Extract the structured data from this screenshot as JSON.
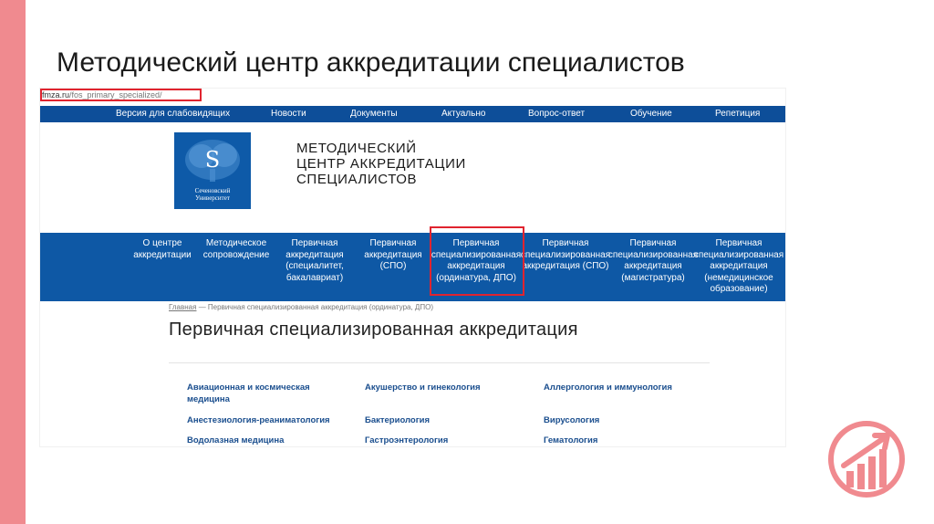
{
  "slide_title": "Методический центр аккредитации специалистов",
  "url": {
    "domain": "fmza.ru",
    "path": "/fos_primary_specialized/"
  },
  "top_nav": [
    "Версия для слабовидящих",
    "Новости",
    "Документы",
    "Актуально",
    "Вопрос-ответ",
    "Обучение",
    "Репетиция"
  ],
  "logo": {
    "line1": "Сеченовский",
    "line2": "Университет"
  },
  "site_title": [
    "МЕТОДИЧЕСКИЙ",
    "ЦЕНТР АККРЕДИТАЦИИ",
    "СПЕЦИАЛИСТОВ"
  ],
  "main_nav": [
    "О центре\nаккредитации",
    "Методическое\nсопровождение",
    "Первичная\nаккредитация\n(специалитет,\nбакалавриат)",
    "Первичная\nаккредитация\n(СПО)",
    "Первичная\nспециализированная\nаккредитация\n(ординатура, ДПО)",
    "Первичная\nспециализированная\nаккредитация (СПО)",
    "Первичная\nспециализированная\nаккредитация\n(магистратура)",
    "Первичная\nспециализированная\nаккредитация\n(немедицинское\nобразование)"
  ],
  "breadcrumb": {
    "home": "Главная",
    "separator": "—",
    "current": "Первичная специализированная аккредитация (ординатура, ДПО)"
  },
  "page_heading": "Первичная специализированная аккредитация",
  "specialties": [
    "Авиационная и космическая\nмедицина",
    "Акушерство и гинекология",
    "Аллергология и иммунология",
    "Анестезиология-реаниматология",
    "Бактериология",
    "Вирусология",
    "Водолазная медицина",
    "Гастроэнтерология",
    "Гематология"
  ],
  "colors": {
    "nav_blue": "#0d4e99",
    "highlight_red": "#e0242f",
    "accent_pink": "#f08a8f",
    "link_blue": "#1a4e8e"
  }
}
